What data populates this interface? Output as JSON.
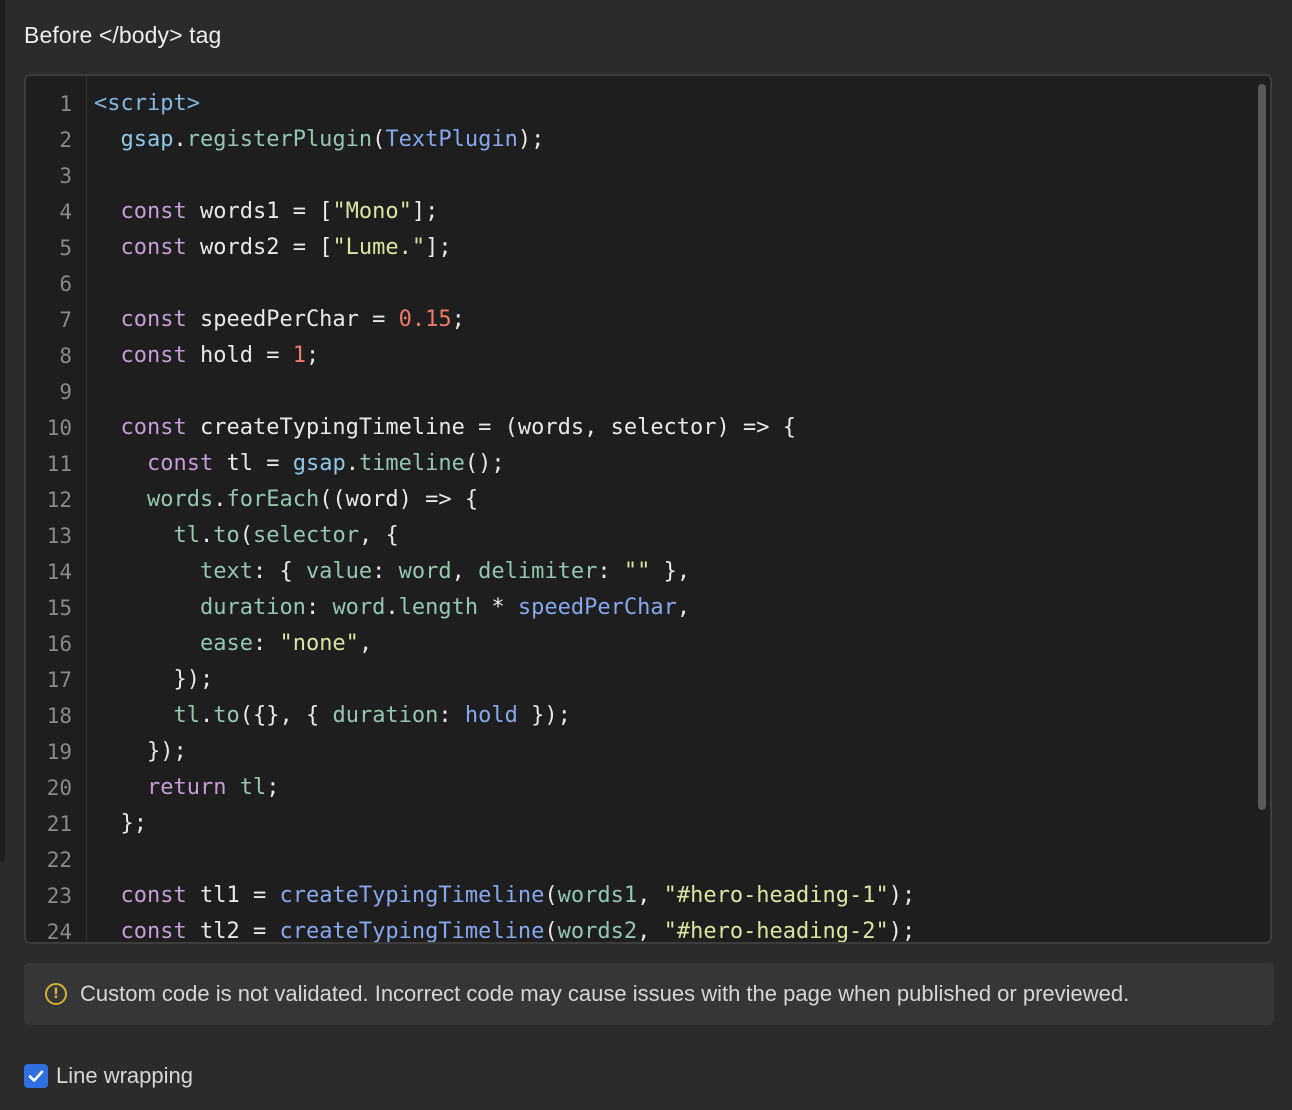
{
  "panel": {
    "title": "Before </body> tag"
  },
  "editor": {
    "line_numbers": [
      "1",
      "2",
      "3",
      "4",
      "5",
      "6",
      "7",
      "8",
      "9",
      "10",
      "11",
      "12",
      "13",
      "14",
      "15",
      "16",
      "17",
      "18",
      "19",
      "20",
      "21",
      "22",
      "23",
      "24"
    ],
    "lines": [
      [
        [
          "tag",
          "<script>"
        ]
      ],
      [
        [
          "plain",
          "  "
        ],
        [
          "var",
          "gsap"
        ],
        [
          "plain",
          "."
        ],
        [
          "prop",
          "registerPlugin"
        ],
        [
          "plain",
          "("
        ],
        [
          "fn",
          "TextPlugin"
        ],
        [
          "plain",
          ");"
        ]
      ],
      [],
      [
        [
          "plain",
          "  "
        ],
        [
          "kw",
          "const"
        ],
        [
          "plain",
          " words1 = ["
        ],
        [
          "str",
          "\"Mono\""
        ],
        [
          "plain",
          "];"
        ]
      ],
      [
        [
          "plain",
          "  "
        ],
        [
          "kw",
          "const"
        ],
        [
          "plain",
          " words2 = ["
        ],
        [
          "str",
          "\"Lume.\""
        ],
        [
          "plain",
          "];"
        ]
      ],
      [],
      [
        [
          "plain",
          "  "
        ],
        [
          "kw",
          "const"
        ],
        [
          "plain",
          " speedPerChar = "
        ],
        [
          "num",
          "0.15"
        ],
        [
          "plain",
          ";"
        ]
      ],
      [
        [
          "plain",
          "  "
        ],
        [
          "kw",
          "const"
        ],
        [
          "plain",
          " hold = "
        ],
        [
          "num",
          "1"
        ],
        [
          "plain",
          ";"
        ]
      ],
      [],
      [
        [
          "plain",
          "  "
        ],
        [
          "kw",
          "const"
        ],
        [
          "plain",
          " createTypingTimeline = (words, selector) => {"
        ]
      ],
      [
        [
          "plain",
          "    "
        ],
        [
          "kw",
          "const"
        ],
        [
          "plain",
          " tl = "
        ],
        [
          "var",
          "gsap"
        ],
        [
          "plain",
          "."
        ],
        [
          "prop",
          "timeline"
        ],
        [
          "plain",
          "();"
        ]
      ],
      [
        [
          "plain",
          "    "
        ],
        [
          "prop",
          "words"
        ],
        [
          "plain",
          "."
        ],
        [
          "prop",
          "forEach"
        ],
        [
          "plain",
          "((word) => {"
        ]
      ],
      [
        [
          "plain",
          "      "
        ],
        [
          "prop",
          "tl"
        ],
        [
          "plain",
          "."
        ],
        [
          "prop",
          "to"
        ],
        [
          "plain",
          "("
        ],
        [
          "prop",
          "selector"
        ],
        [
          "plain",
          ", {"
        ]
      ],
      [
        [
          "plain",
          "        "
        ],
        [
          "prop",
          "text"
        ],
        [
          "plain",
          ": { "
        ],
        [
          "prop",
          "value"
        ],
        [
          "plain",
          ": "
        ],
        [
          "prop",
          "word"
        ],
        [
          "plain",
          ", "
        ],
        [
          "prop",
          "delimiter"
        ],
        [
          "plain",
          ": "
        ],
        [
          "str",
          "\"\""
        ],
        [
          "plain",
          " },"
        ]
      ],
      [
        [
          "plain",
          "        "
        ],
        [
          "prop",
          "duration"
        ],
        [
          "plain",
          ": "
        ],
        [
          "prop",
          "word"
        ],
        [
          "plain",
          "."
        ],
        [
          "prop",
          "length"
        ],
        [
          "plain",
          " * "
        ],
        [
          "fn",
          "speedPerChar"
        ],
        [
          "plain",
          ","
        ]
      ],
      [
        [
          "plain",
          "        "
        ],
        [
          "prop",
          "ease"
        ],
        [
          "plain",
          ": "
        ],
        [
          "str",
          "\"none\""
        ],
        [
          "plain",
          ","
        ]
      ],
      [
        [
          "plain",
          "      });"
        ]
      ],
      [
        [
          "plain",
          "      "
        ],
        [
          "prop",
          "tl"
        ],
        [
          "plain",
          "."
        ],
        [
          "prop",
          "to"
        ],
        [
          "plain",
          "({}, { "
        ],
        [
          "prop",
          "duration"
        ],
        [
          "plain",
          ": "
        ],
        [
          "fn",
          "hold"
        ],
        [
          "plain",
          " });"
        ]
      ],
      [
        [
          "plain",
          "    });"
        ]
      ],
      [
        [
          "plain",
          "    "
        ],
        [
          "kw",
          "return"
        ],
        [
          "plain",
          " "
        ],
        [
          "prop",
          "tl"
        ],
        [
          "plain",
          ";"
        ]
      ],
      [
        [
          "plain",
          "  };"
        ]
      ],
      [],
      [
        [
          "plain",
          "  "
        ],
        [
          "kw",
          "const"
        ],
        [
          "plain",
          " tl1 = "
        ],
        [
          "fn",
          "createTypingTimeline"
        ],
        [
          "plain",
          "("
        ],
        [
          "prop",
          "words1"
        ],
        [
          "plain",
          ", "
        ],
        [
          "str",
          "\"#hero-heading-1\""
        ],
        [
          "plain",
          ");"
        ]
      ],
      [
        [
          "plain",
          "  "
        ],
        [
          "kw",
          "const"
        ],
        [
          "plain",
          " tl2 = "
        ],
        [
          "fn",
          "createTypingTimeline"
        ],
        [
          "plain",
          "("
        ],
        [
          "prop",
          "words2"
        ],
        [
          "plain",
          ", "
        ],
        [
          "str",
          "\"#hero-heading-2\""
        ],
        [
          "plain",
          ");"
        ]
      ]
    ]
  },
  "notice": {
    "icon": "warning-circle-icon",
    "text": "Custom code is not validated. Incorrect code may cause issues with the page when published or previewed."
  },
  "options": {
    "line_wrapping_label": "Line wrapping",
    "line_wrapping_checked": true
  },
  "colors": {
    "accent": "#2f6fe0",
    "warning": "#d4b03a"
  }
}
